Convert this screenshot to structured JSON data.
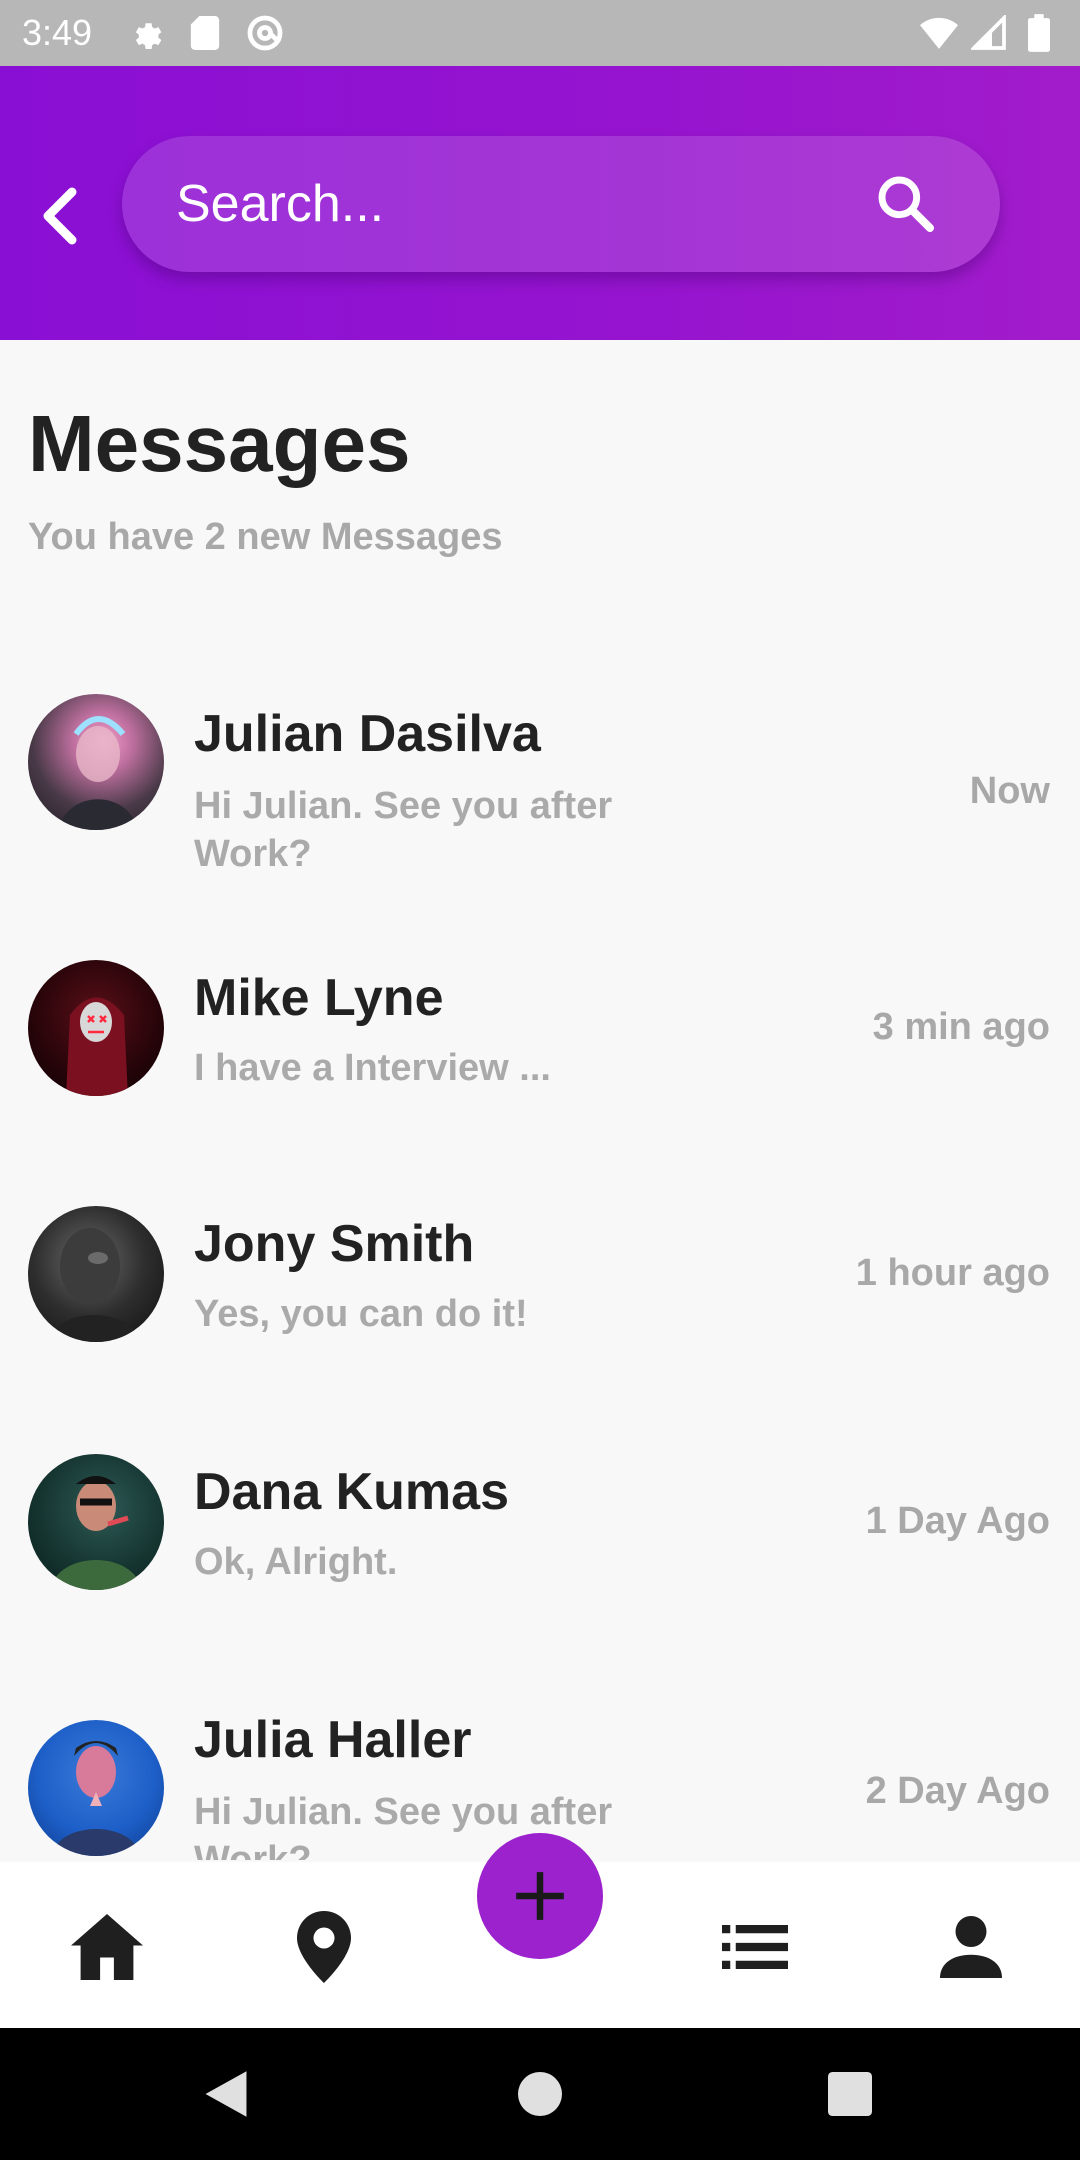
{
  "status_bar": {
    "time": "3:49",
    "left_icons": [
      "settings-icon",
      "sd-card-icon",
      "at-sign-icon"
    ],
    "right_icons": [
      "wifi-icon",
      "cell-signal-icon",
      "battery-icon"
    ]
  },
  "header": {
    "back_icon": "chevron-left-icon",
    "search_placeholder": "Search...",
    "search_icon": "search-icon",
    "gradient_colors": [
      "#8a0fd4",
      "#a21ccb"
    ]
  },
  "page": {
    "title": "Messages",
    "subtitle": "You have 2 new Messages"
  },
  "messages": [
    {
      "name": "Julian Dasilva",
      "preview": "Hi Julian. See you after Work?",
      "time": "Now"
    },
    {
      "name": "Mike Lyne",
      "preview": "I have a Interview ...",
      "time": "3 min ago"
    },
    {
      "name": "Jony Smith",
      "preview": "Yes, you can do it!",
      "time": "1 hour ago"
    },
    {
      "name": "Dana Kumas",
      "preview": "Ok, Alright.",
      "time": "1 Day Ago"
    },
    {
      "name": "Julia Haller",
      "preview": "Hi Julian. See you after Work?",
      "time": "2 Day Ago"
    }
  ],
  "bottom_nav": {
    "items": [
      "home-icon",
      "location-pin-icon",
      "list-icon",
      "person-icon"
    ],
    "fab_icon": "plus-icon",
    "fab_color": "#9b22cc"
  },
  "system_nav": [
    "back-triangle-icon",
    "home-circle-icon",
    "recents-square-icon"
  ]
}
